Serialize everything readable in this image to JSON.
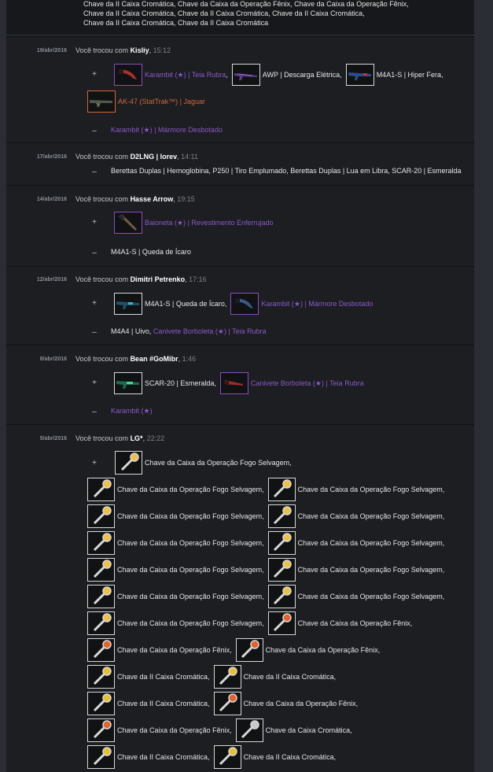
{
  "top_lines": [
    "Chave da II Caixa Cromática, Chave da Caixa da Operação Fênix, Chave da Caixa da Operação Fênix,",
    "Chave da II Caixa Cromática, Chave da II Caixa Cromática, Chave da II Caixa Cromática,",
    "Chave da II Caixa Cromática, Chave da II Caixa Cromática"
  ],
  "trades": [
    {
      "date": "19/abr/2016",
      "prefix": "Você trocou com",
      "user": "Kisliy",
      "time": "15:12",
      "received": [
        {
          "name": "Karambit (★) | Teia Rubra",
          "suffix": ",",
          "rarity": "covert",
          "icon": "knife-icon"
        },
        {
          "name": "AWP | Descarga Elétrica",
          "suffix": ",",
          "rarity": "normal",
          "icon": "rifle-icon"
        },
        {
          "name": "M4A1-S | Hiper Fera",
          "suffix": ",",
          "rarity": "normal",
          "icon": "rifle-icon"
        },
        {
          "name": "AK-47 (StatTrak™) | Jaguar",
          "suffix": "",
          "rarity": "orange",
          "icon": "rifle-icon"
        }
      ],
      "given_text": "Karambit (★) | Mármore Desbotado",
      "given_rarity": "covert"
    },
    {
      "date": "17/abr/2016",
      "prefix": "Você trocou com",
      "user": "D2LNG | lorev",
      "time": "14:11",
      "given_text": "Berettas Duplas | Hemoglobina, P250 | Tiro Emplumado, Berettas Duplas | Lua em Libra, SCAR-20 | Esmeralda"
    },
    {
      "date": "14/abr/2016",
      "prefix": "Você trocou com",
      "user": "Hasse Arrow",
      "time": "19:15",
      "received": [
        {
          "name": "Baioneta (★) | Revestimento Enferrujado",
          "suffix": "",
          "rarity": "covert",
          "icon": "knife-icon"
        }
      ],
      "given_text": "M4A1-S | Queda de Ícaro"
    },
    {
      "date": "12/abr/2016",
      "prefix": "Você trocou com",
      "user": "Dimitri Petrenko",
      "time": "17:16",
      "received": [
        {
          "name": "M4A1-S | Queda de Ícaro",
          "suffix": ",",
          "rarity": "normal",
          "icon": "rifle-icon"
        },
        {
          "name": "Karambit (★) | Mármore Desbotado",
          "suffix": "",
          "rarity": "covert",
          "icon": "knife-icon"
        }
      ],
      "given_plain": "M4A4 | Uivo, ",
      "given_colored": "Canivete Borboleta (★) | Teia Rubra"
    },
    {
      "date": "8/abr/2016",
      "prefix": "Você trocou com",
      "user": "Bean #GoMibr",
      "time": "1:46",
      "received": [
        {
          "name": "SCAR-20 | Esmeralda",
          "suffix": ",",
          "rarity": "normal",
          "icon": "rifle-icon"
        },
        {
          "name": "Canivete Borboleta (★) | Teia Rubra",
          "suffix": "",
          "rarity": "covert",
          "icon": "knife-icon"
        }
      ],
      "given_text": "Karambit (★)",
      "given_rarity": "covert"
    },
    {
      "date": "5/abr/2016",
      "prefix": "Você trocou com",
      "user": "LG*",
      "time": "22:22",
      "first_key": {
        "name": "Chave da Caixa da Operação Fogo Selvagem",
        "suffix": ",",
        "icon": "key-icon"
      },
      "key_rows": [
        [
          {
            "name": "Chave da Caixa da Operação Fogo Selvagem",
            "suffix": ",",
            "kind": "wildfire"
          },
          {
            "name": "Chave da Caixa da Operação Fogo Selvagem",
            "suffix": ",",
            "kind": "wildfire"
          }
        ],
        [
          {
            "name": "Chave da Caixa da Operação Fogo Selvagem",
            "suffix": ",",
            "kind": "wildfire"
          },
          {
            "name": "Chave da Caixa da Operação Fogo Selvagem",
            "suffix": ",",
            "kind": "wildfire"
          }
        ],
        [
          {
            "name": "Chave da Caixa da Operação Fogo Selvagem",
            "suffix": ",",
            "kind": "wildfire"
          },
          {
            "name": "Chave da Caixa da Operação Fogo Selvagem",
            "suffix": ",",
            "kind": "wildfire"
          }
        ],
        [
          {
            "name": "Chave da Caixa da Operação Fogo Selvagem",
            "suffix": ",",
            "kind": "wildfire"
          },
          {
            "name": "Chave da Caixa da Operação Fogo Selvagem",
            "suffix": ",",
            "kind": "wildfire"
          }
        ],
        [
          {
            "name": "Chave da Caixa da Operação Fogo Selvagem",
            "suffix": ",",
            "kind": "wildfire"
          },
          {
            "name": "Chave da Caixa da Operação Fogo Selvagem",
            "suffix": ",",
            "kind": "wildfire"
          }
        ],
        [
          {
            "name": "Chave da Caixa da Operação Fogo Selvagem",
            "suffix": ",",
            "kind": "wildfire"
          },
          {
            "name": "Chave da Caixa da Operação Fênix",
            "suffix": ",",
            "kind": "phoenix"
          }
        ],
        [
          {
            "name": "Chave da Caixa da Operação Fênix",
            "suffix": ",",
            "kind": "phoenix"
          },
          {
            "name": "Chave da Caixa da Operação Fênix",
            "suffix": ",",
            "kind": "phoenix"
          }
        ],
        [
          {
            "name": "Chave da II Caixa Cromática",
            "suffix": ",",
            "kind": "chroma"
          },
          {
            "name": "Chave da II Caixa Cromática",
            "suffix": ",",
            "kind": "chroma"
          }
        ],
        [
          {
            "name": "Chave da II Caixa Cromática",
            "suffix": ",",
            "kind": "chroma"
          },
          {
            "name": "Chave da Caixa da Operação Fênix",
            "suffix": ",",
            "kind": "phoenix"
          }
        ],
        [
          {
            "name": "Chave da Caixa da Operação Fênix",
            "suffix": ",",
            "kind": "phoenix"
          },
          {
            "name": "Chave da Caixa Cromática",
            "suffix": ",",
            "kind": "chroma1"
          }
        ],
        [
          {
            "name": "Chave da II Caixa Cromática",
            "suffix": ",",
            "kind": "chroma"
          },
          {
            "name": "Chave da II Caixa Cromática",
            "suffix": ",",
            "kind": "chroma"
          }
        ]
      ]
    }
  ],
  "signs": {
    "plus": "+",
    "minus": "–"
  },
  "colors": {
    "covert": "#8b58c6",
    "stattrak": "#cf6a32",
    "background": "#1e2024"
  }
}
